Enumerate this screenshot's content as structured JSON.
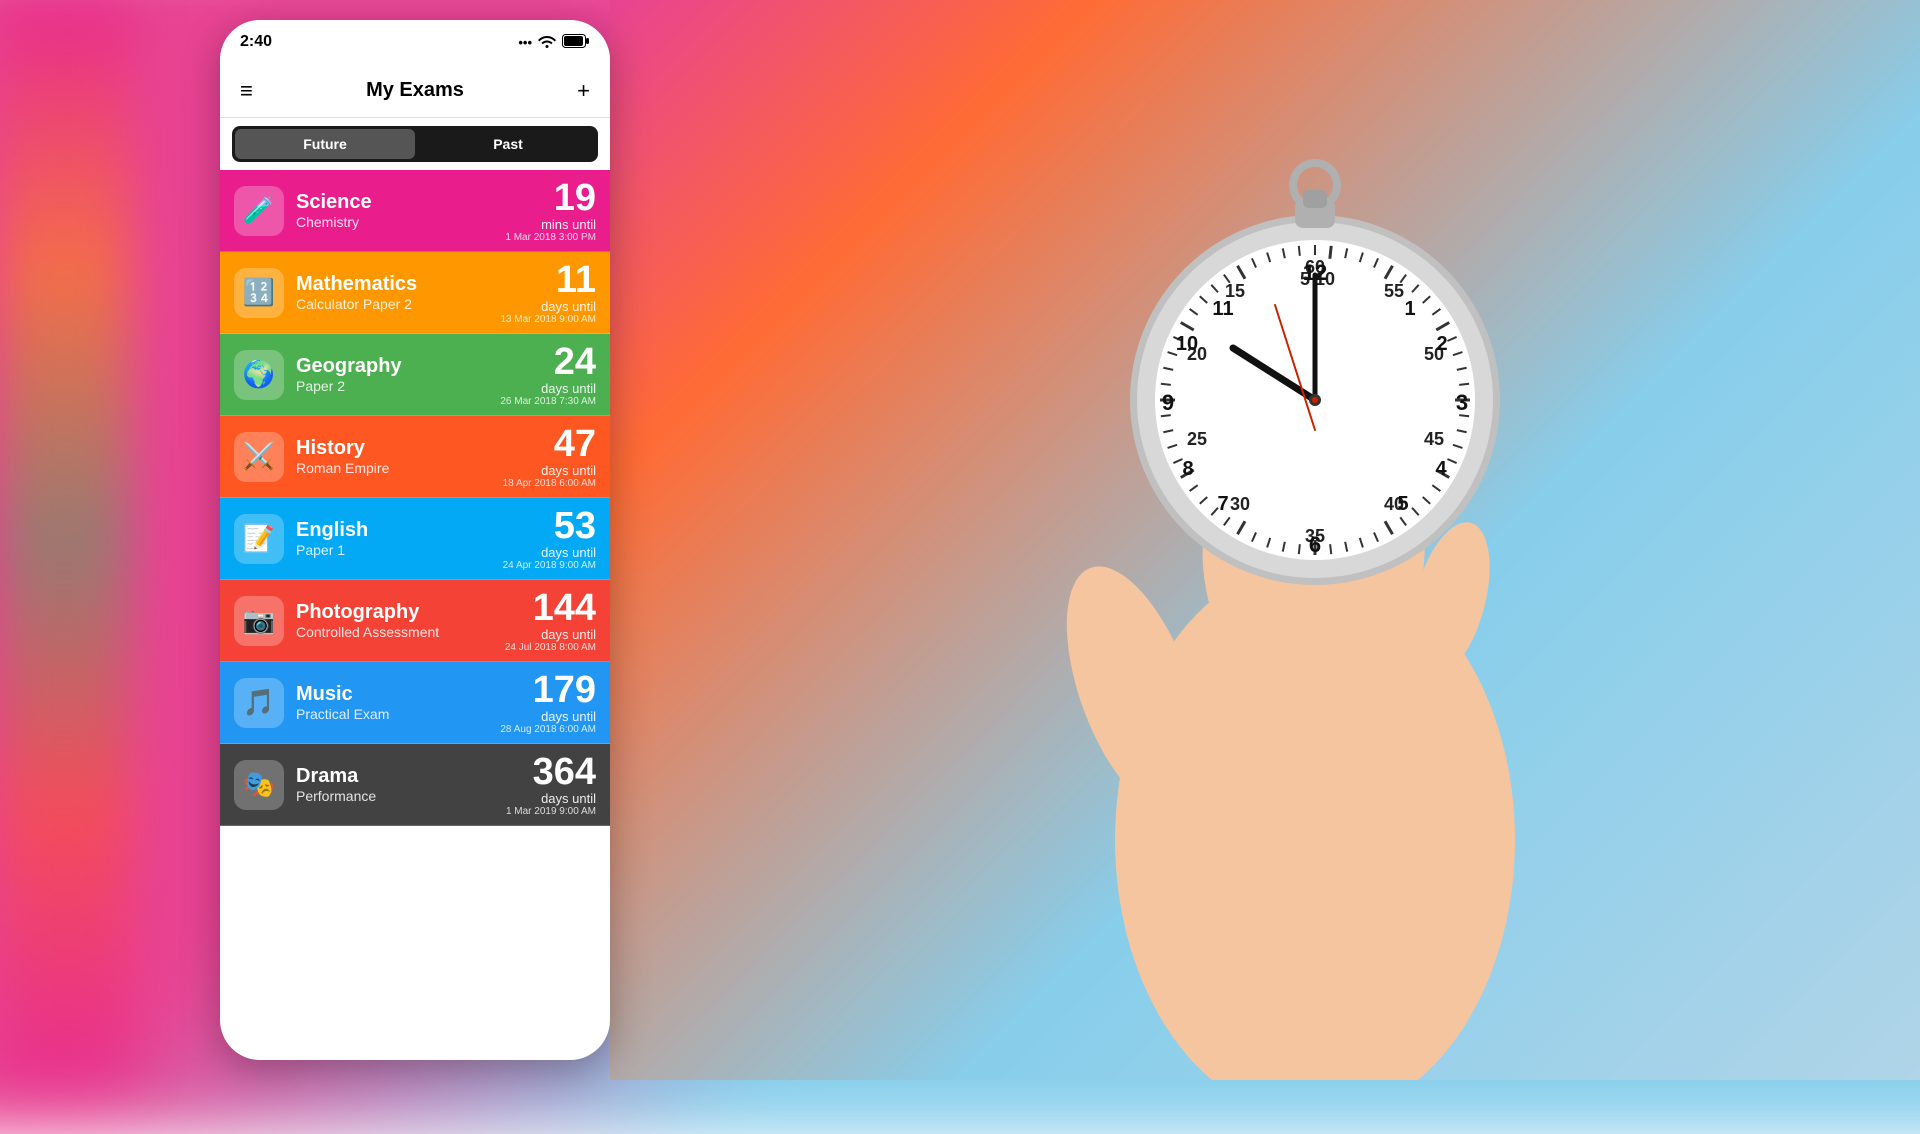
{
  "app": {
    "status": {
      "time": "2:40",
      "signal": "...",
      "wifi": "wifi",
      "battery": "battery"
    },
    "header": {
      "title": "My Exams",
      "menu_icon": "≡",
      "add_icon": "+"
    },
    "segments": [
      {
        "label": "Future",
        "active": true
      },
      {
        "label": "Past",
        "active": false
      }
    ],
    "exams": [
      {
        "subject": "Science",
        "detail": "Chemistry",
        "number": "19",
        "unit": "mins until",
        "date": "1 Mar 2018 3:00 PM",
        "color": "exam-science",
        "icon": "🧪"
      },
      {
        "subject": "Mathematics",
        "detail": "Calculator Paper 2",
        "number": "11",
        "unit": "days until",
        "date": "13 Mar 2018 9:00 AM",
        "color": "exam-maths",
        "icon": "🔢"
      },
      {
        "subject": "Geography",
        "detail": "Paper 2",
        "number": "24",
        "unit": "days until",
        "date": "26 Mar 2018 7:30 AM",
        "color": "exam-geography",
        "icon": "🌍"
      },
      {
        "subject": "History",
        "detail": "Roman Empire",
        "number": "47",
        "unit": "days until",
        "date": "18 Apr 2018 6:00 AM",
        "color": "exam-history",
        "icon": "⚔️"
      },
      {
        "subject": "English",
        "detail": "Paper 1",
        "number": "53",
        "unit": "days until",
        "date": "24 Apr 2018 9:00 AM",
        "color": "exam-english",
        "icon": "📝"
      },
      {
        "subject": "Photography",
        "detail": "Controlled Assessment",
        "number": "144",
        "unit": "days until",
        "date": "24 Jul 2018 8:00 AM",
        "color": "exam-photography",
        "icon": "📷"
      },
      {
        "subject": "Music",
        "detail": "Practical Exam",
        "number": "179",
        "unit": "days until",
        "date": "28 Aug 2018 6:00 AM",
        "color": "exam-music",
        "icon": "🎵"
      },
      {
        "subject": "Drama",
        "detail": "Performance",
        "number": "364",
        "unit": "days until",
        "date": "1 Mar 2019 9:00 AM",
        "color": "exam-drama",
        "icon": "🎭"
      }
    ]
  }
}
